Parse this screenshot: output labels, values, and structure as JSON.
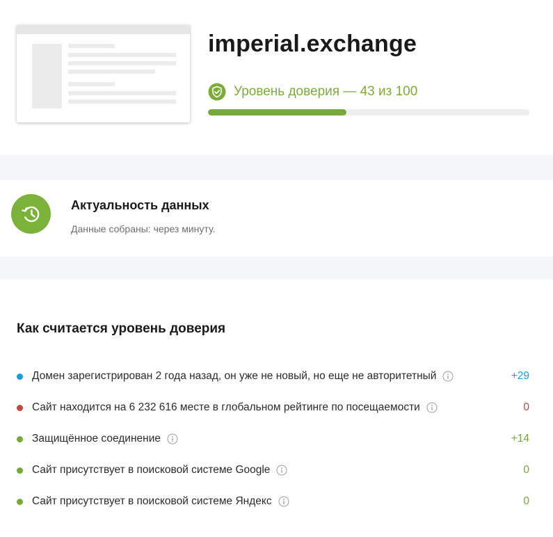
{
  "header": {
    "site_name": "imperial.exchange",
    "trust_label": "Уровень доверия — 43 из 100",
    "trust_score": 43,
    "trust_max": 100,
    "accent_color": "#77a83b"
  },
  "freshness": {
    "title": "Актуальность данных",
    "subtitle": "Данные собраны: через минуту.",
    "icon": "clock-history-icon"
  },
  "factors": {
    "title": "Как считается уровень доверия",
    "items": [
      {
        "label": "Домен зарегистрирован 2 года назад, он уже не новый, но еще не авторитетный",
        "score": "+29",
        "color": "#1a9be2"
      },
      {
        "label": "Сайт находится на 6 232 616 месте в глобальном рейтинге по посещаемости",
        "score": "0",
        "color": "#c9443b"
      },
      {
        "label": "Защищённое соединение",
        "score": "+14",
        "color": "#77a83b"
      },
      {
        "label": "Сайт присутствует в поисковой системе Google",
        "score": "0",
        "color": "#77a83b"
      },
      {
        "label": "Сайт присутствует в поисковой системе Яндекс",
        "score": "0",
        "color": "#77a83b"
      }
    ]
  }
}
